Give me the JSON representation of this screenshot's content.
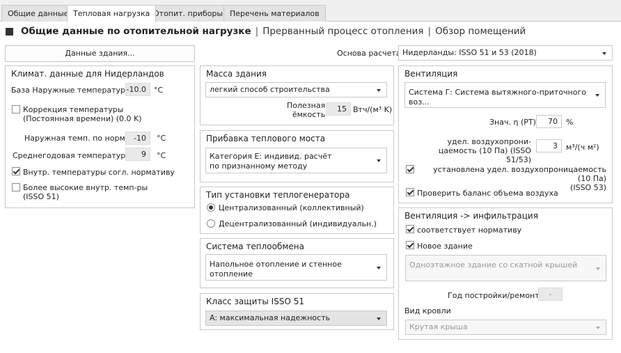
{
  "tabs": [
    {
      "label": "Общие данные",
      "active": false
    },
    {
      "label": "Тепловая нагрузка",
      "active": true
    },
    {
      "label": "Отопит. приборы",
      "active": false
    },
    {
      "label": "Перечень материалов",
      "active": false
    }
  ],
  "subnav": {
    "current": "Общие данные по отопительной нагрузке",
    "link1": "Прерванный процесс отопления",
    "link2": "Обзор помещений",
    "separator": "|"
  },
  "building_button": "Данные здания...",
  "basis": {
    "label": "Основа расчета",
    "value": "Нидерланды: ISSO 51 и 53 (2018)"
  },
  "climate": {
    "title": "Климат. данные для Нидерландов",
    "base_temp_label": "База Наружные температуры",
    "base_temp_value": "-10.0",
    "base_temp_unit": "°C",
    "correction_label": "Коррекция температуры\n(Постоянная времени) (0.0 K)",
    "correction_checked": false,
    "norm_temp_label": "Наружная темп. по норме",
    "norm_temp_value": "-10",
    "norm_temp_unit": "°C",
    "avg_temp_label": "Среднегодовая температура",
    "avg_temp_value": "9",
    "avg_temp_unit": "°C",
    "inner_norm_label": "Внутр. температуры согл. нормативу",
    "inner_norm_checked": true,
    "higher_inner_label": "Более высокие внутр. темп-ры\n(ISSO 51)",
    "higher_inner_checked": false
  },
  "mass": {
    "title": "Масса здания",
    "value": "легкий способ строительства",
    "capacity_label": "Полезная\nёмкость",
    "capacity_value": "15",
    "capacity_unit": "Втч/(м³ K)"
  },
  "thermal_bridge": {
    "title": "Прибавка теплового моста",
    "value": "Категория E: индивид. расчёт\nпо признанному методу"
  },
  "generator": {
    "title": "Тип установки теплогенератора",
    "option1": "Централизованный (коллективный)",
    "option2": "Децентрализованный (индивидуальн.)",
    "selected": 1
  },
  "exchange": {
    "title": "Система теплообмена",
    "value": "Напольное отопление и стенное отопление"
  },
  "protection": {
    "title": "Класс защиты ISSO 51",
    "value": "A: максимальная надежность"
  },
  "ventilation": {
    "title": "Вентиляция",
    "system": "Система Г: Система вытяжного-приточного воз...",
    "eta_label": "Знач. η (PT)",
    "eta_value": "70",
    "eta_unit": "%",
    "perm_label": "удел. воздухопрони-\nцаемость (10 Па) (ISSO 51/53)",
    "perm_value": "3",
    "perm_unit": "м³/(ч м²)",
    "perm_set_label": "установлена удел. воздухопроницаемость (10 Па)\n(ISSO 53)",
    "perm_set_checked": true,
    "balance_label": "Проверить баланс объема воздуха",
    "balance_checked": true
  },
  "infiltration": {
    "title": "Вентиляция -> инфильтрация",
    "norm_label": "соответствует нормативу",
    "norm_checked": true,
    "new_label": "Новое здание",
    "new_checked": true,
    "building_type": "Одноэтажное здание со скатной крышей",
    "year_label": "Год постройки/ремонта",
    "year_value": "-",
    "roof_label": "Вид кровли",
    "roof_value": "Крутая крыша"
  }
}
